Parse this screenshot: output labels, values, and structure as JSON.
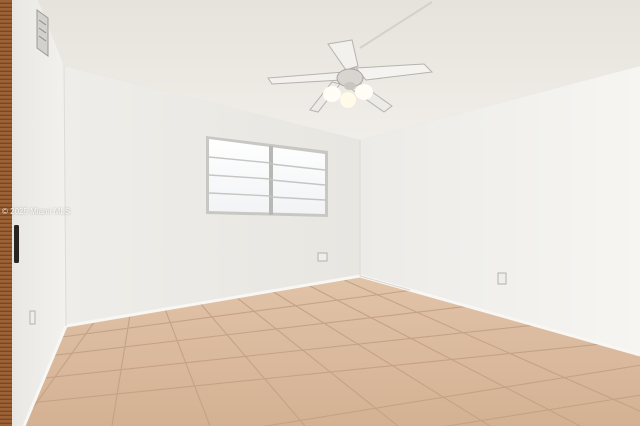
{
  "watermark": "© 2025 Miami MLS",
  "colors": {
    "ceiling": "#ebe8e3",
    "left_wall": "#eceae6",
    "back_wall": "#e9e7e2",
    "right_wall": "#f2f1ee",
    "floor_tile": "#d7b69a",
    "grout": "#c19f85",
    "baseboard": "#f7f6f3",
    "door": "#a0673c"
  },
  "objects": [
    "ceiling-fan",
    "window",
    "closet-door",
    "air-vent",
    "tile-floor",
    "wall-outlet"
  ]
}
